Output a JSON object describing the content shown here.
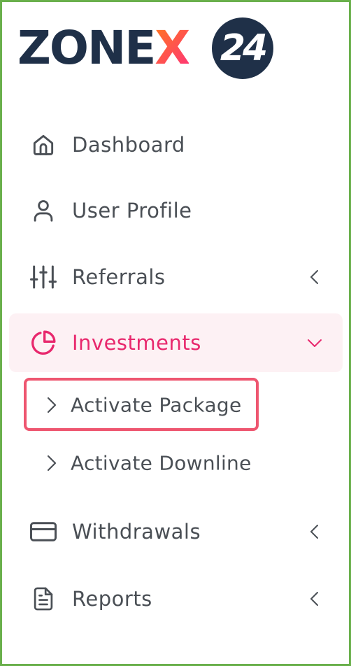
{
  "logo": {
    "text_main": "ZONE",
    "text_x": "X",
    "badge": "24"
  },
  "menu": {
    "dashboard": {
      "label": "Dashboard",
      "icon": "home-icon"
    },
    "user_profile": {
      "label": "User Profile",
      "icon": "user-icon"
    },
    "referrals": {
      "label": "Referrals",
      "icon": "sliders-icon"
    },
    "investments": {
      "label": "Investments",
      "icon": "pie-chart-icon",
      "expanded": true,
      "subitems": [
        {
          "label": "Activate Package",
          "highlighted": true
        },
        {
          "label": "Activate Downline"
        }
      ]
    },
    "withdrawals": {
      "label": "Withdrawals",
      "icon": "credit-card-icon"
    },
    "reports": {
      "label": "Reports",
      "icon": "file-text-icon"
    }
  },
  "colors": {
    "text": "#4a4f55",
    "accent": "#e8286d",
    "active_bg": "#fdf1f4",
    "highlight_border": "#ee5670",
    "frame_border": "#6ab04c",
    "logo_navy": "#1f3048"
  }
}
